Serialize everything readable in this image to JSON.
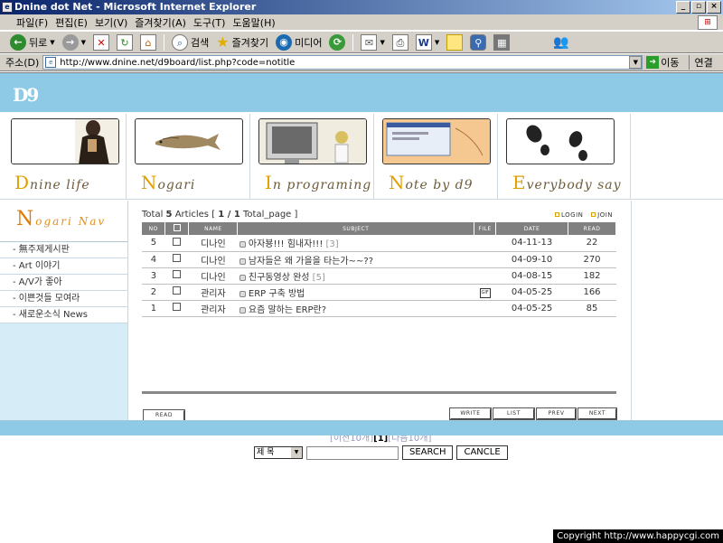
{
  "window": {
    "title": "Dnine dot Net - Microsoft Internet Explorer",
    "app_icon": "ie-icon",
    "controls": [
      "_",
      "▫",
      "×"
    ]
  },
  "menubar": {
    "items": [
      "파일(F)",
      "편집(E)",
      "보기(V)",
      "즐겨찾기(A)",
      "도구(T)",
      "도움말(H)"
    ]
  },
  "toolbar": {
    "back_label": "뒤로",
    "search_label": "검색",
    "favorites_label": "즐겨찾기",
    "media_label": "미디어"
  },
  "addressbar": {
    "label": "주소(D)",
    "url": "http://www.dnine.net/d9board/list.php?code=notitle",
    "go_label": "이동",
    "links_label": "연결"
  },
  "site": {
    "logo": "D9",
    "nav": [
      {
        "cap": "D",
        "rest": "nine life"
      },
      {
        "cap": "N",
        "rest": "ogari"
      },
      {
        "cap": "I",
        "rest": "n programing"
      },
      {
        "cap": "N",
        "rest": "ote by d9"
      },
      {
        "cap": "E",
        "rest": "verybody say"
      }
    ]
  },
  "sidebar": {
    "title_cap": "N",
    "title_rest": "ogari Nav",
    "items": [
      "- 無주제게시판",
      "- Art 이야기",
      "- A/V가 좋아",
      "- 이쁜것들 모여라",
      "- 새로운소식 News"
    ]
  },
  "board": {
    "total_prefix": "Total",
    "total_count": "5",
    "total_suffix": "Articles",
    "page_open": "[",
    "page_current": "1 / 1",
    "page_suffix": "Total_page ]",
    "login_label": "LOGIN",
    "join_label": "JOIN",
    "columns": [
      "NO",
      "",
      "NAME",
      "SUBJECT",
      "FILE",
      "DATE",
      "READ"
    ],
    "rows": [
      {
        "no": "5",
        "name": "디나인",
        "subject": "아자뵹!!! 힘내자!!!",
        "comments": "[3]",
        "file": "",
        "date": "04-11-13",
        "read": "22"
      },
      {
        "no": "4",
        "name": "디나인",
        "subject": "남자들은 왜 가을을 타는가~~??",
        "comments": "",
        "file": "",
        "date": "04-09-10",
        "read": "270"
      },
      {
        "no": "3",
        "name": "디나인",
        "subject": "친구동영상 완성",
        "comments": "[5]",
        "file": "",
        "date": "04-08-15",
        "read": "182"
      },
      {
        "no": "2",
        "name": "관리자",
        "subject": "ERP 구축 방법",
        "comments": "",
        "file": "GIF",
        "date": "04-05-25",
        "read": "166"
      },
      {
        "no": "1",
        "name": "관리자",
        "subject": "요즘 말하는 ERP란?",
        "comments": "",
        "file": "",
        "date": "04-05-25",
        "read": "85"
      }
    ],
    "read_btn": "READ",
    "write_btn": "WRITE",
    "list_btn": "LIST",
    "prev_btn": "PREV",
    "next_btn": "NEXT",
    "paging_prev": "[이전10개]",
    "paging_current": "[1]",
    "paging_next": "[다음10개]",
    "search_select": "제 목",
    "search_value": "",
    "search_btn": "SEARCH",
    "cancel_btn": "CANCLE"
  },
  "footer": {
    "copyright": "Copyright  http://www.happycgi.com"
  }
}
